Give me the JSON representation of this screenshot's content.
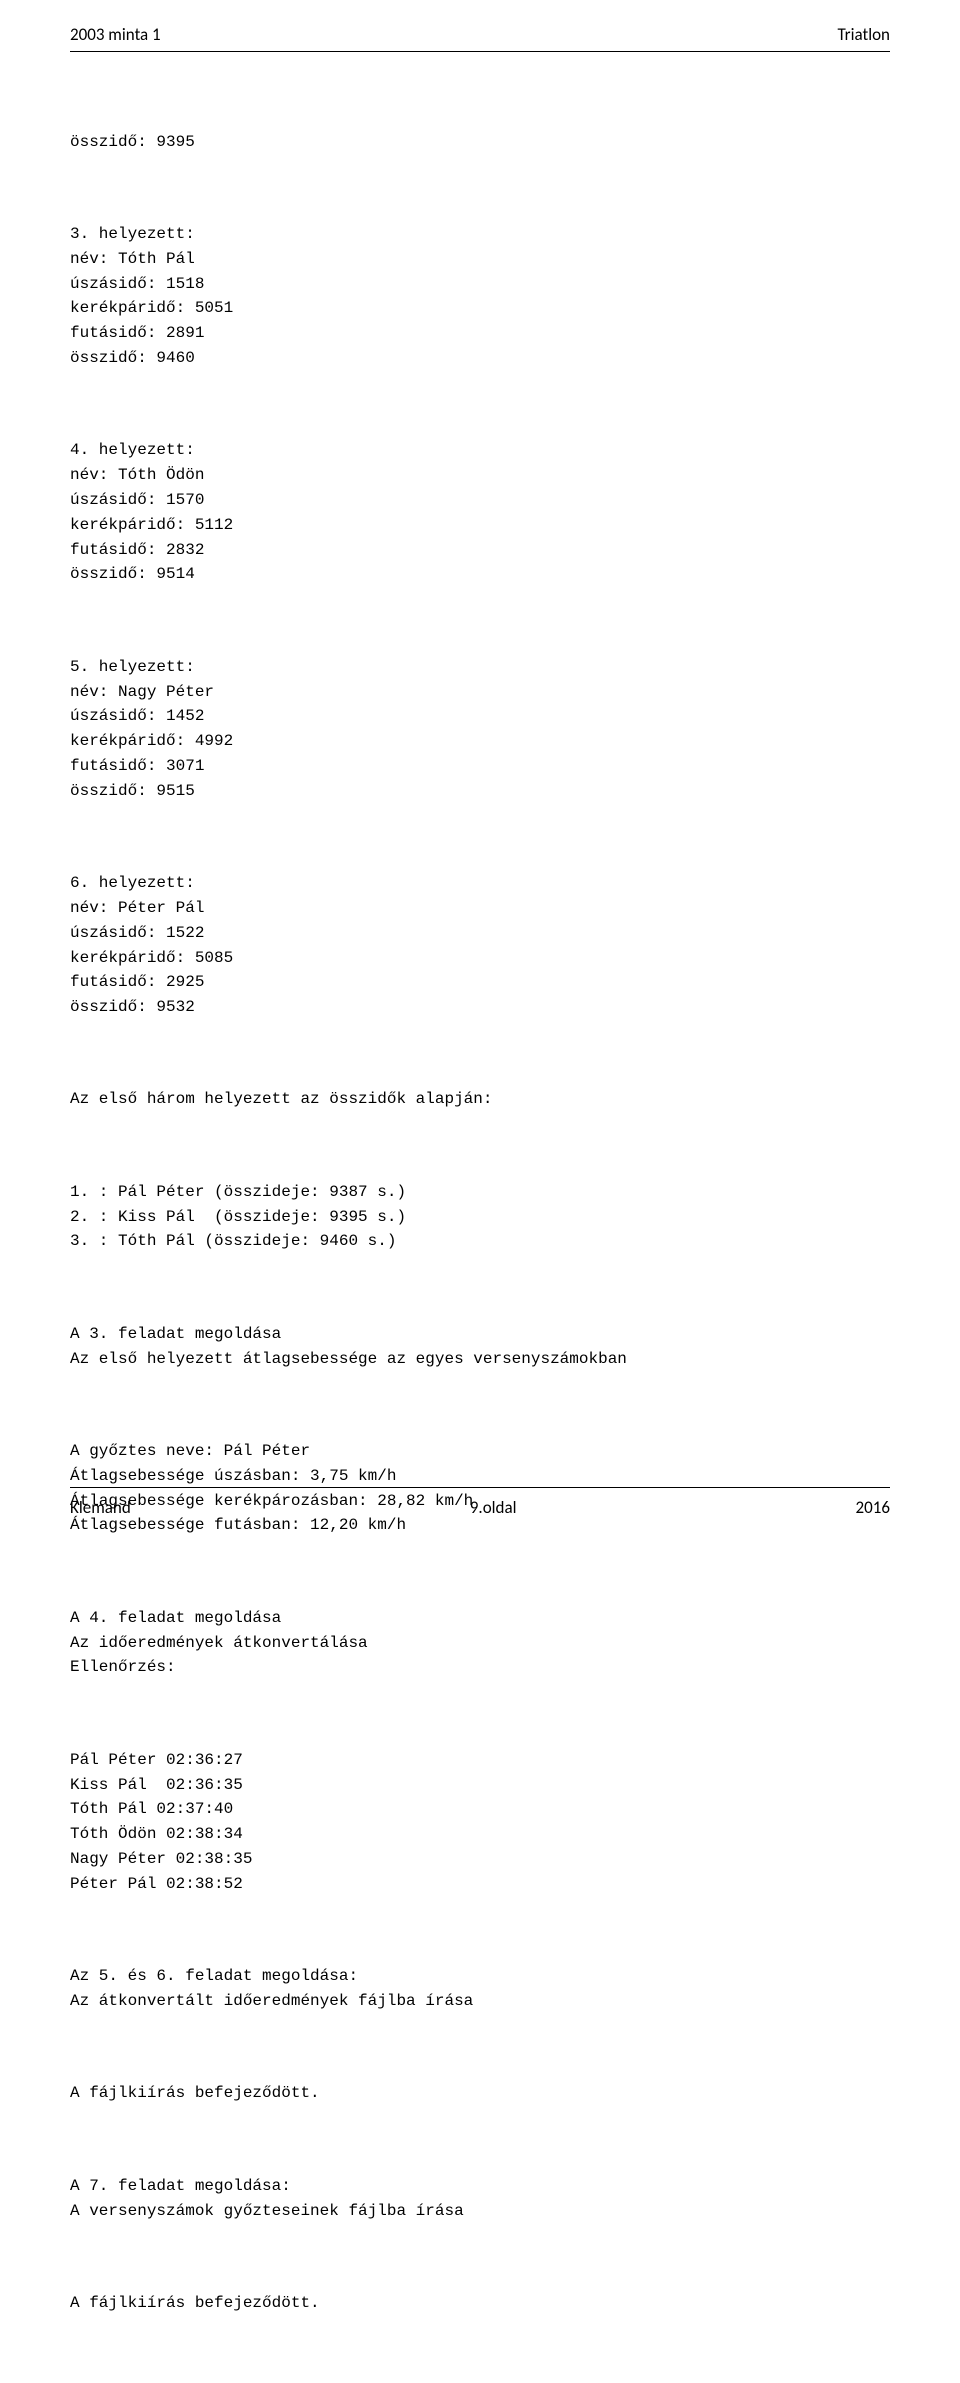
{
  "header": {
    "left": "2003 minta 1",
    "right": "Triatlon"
  },
  "blocks": {
    "totalTop": "összidő: 9395",
    "p3": "3. helyezett:\nnév: Tóth Pál\núszásidő: 1518\nkerékpáridő: 5051\nfutásidő: 2891\nösszidő: 9460",
    "p4": "4. helyezett:\nnév: Tóth Ödön\núszásidő: 1570\nkerékpáridő: 5112\nfutásidő: 2832\nösszidő: 9514",
    "p5": "5. helyezett:\nnév: Nagy Péter\núszásidő: 1452\nkerékpáridő: 4992\nfutásidő: 3071\nösszidő: 9515",
    "p6": "6. helyezett:\nnév: Péter Pál\núszásidő: 1522\nkerékpáridő: 5085\nfutásidő: 2925\nösszidő: 9532",
    "top3Title": "Az első három helyezett az összidők alapján:",
    "top3List": "1. : Pál Péter (összideje: 9387 s.)\n2. : Kiss Pál  (összideje: 9395 s.)\n3. : Tóth Pál (összideje: 9460 s.)",
    "task3": "A 3. feladat megoldása\nAz első helyezett átlagsebessége az egyes versenyszámokban",
    "winnerSpeeds": "A győztes neve: Pál Péter\nÁtlagsebessége úszásban: 3,75 km/h\nÁtlagsebessége kerékpározásban: 28,82 km/h\nÁtlagsebessége futásban: 12,20 km/h",
    "task4": "A 4. feladat megoldása\nAz időeredmények átkonvertálása\nEllenőrzés:",
    "times": "Pál Péter 02:36:27\nKiss Pál  02:36:35\nTóth Pál 02:37:40\nTóth Ödön 02:38:34\nNagy Péter 02:38:35\nPéter Pál 02:38:52",
    "task56": "Az 5. és 6. feladat megoldása:\nAz átkonvertált időeredmények fájlba írása",
    "fileDone1": "A fájlkiírás befejeződött.",
    "task7": "A 7. feladat megoldása:\nA versenyszámok győzteseinek fájlba írása",
    "fileDone2": "A fájlkiírás befejeződött."
  },
  "footer": {
    "left": "Klemand",
    "center": "9.oldal",
    "right": "2016"
  }
}
